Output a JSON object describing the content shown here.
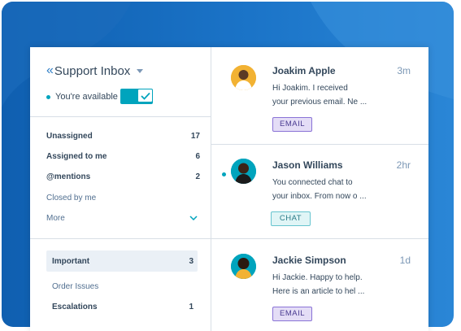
{
  "colors": {
    "accent": "#00a4bd",
    "text_dark": "#33475b",
    "text_muted": "#7c98b6",
    "background_blue": "#1b74c8",
    "email_tag": "#e4ddf6",
    "chat_tag": "#e0f5f6"
  },
  "sidebar": {
    "collapse_icon": "double-chevron-left-icon",
    "inbox_title": "Support Inbox",
    "availability_label": "You're available",
    "availability_on": true,
    "nav": [
      {
        "label": "Unassigned",
        "count": "17"
      },
      {
        "label": "Assigned to me",
        "count": "6"
      },
      {
        "label": "@mentions",
        "count": "2"
      },
      {
        "label": "Closed by me",
        "count": ""
      },
      {
        "label": "More",
        "count": ""
      }
    ],
    "views": [
      {
        "label": "Important",
        "count": "3",
        "selected": true
      },
      {
        "label": "Order Issues",
        "count": ""
      },
      {
        "label": "Escalations",
        "count": "1"
      }
    ]
  },
  "conversations": [
    {
      "name": "Joakim Apple",
      "time": "3m",
      "preview_line1": "Hi Joakim. I received",
      "preview_line2": "your previous email. Ne ...",
      "channel": "EMAIL",
      "unread": false
    },
    {
      "name": "Jason Williams",
      "time": "2hr",
      "preview_line1": "You connected chat to",
      "preview_line2": "your inbox. From now o ...",
      "channel": "CHAT",
      "unread": true
    },
    {
      "name": "Jackie Simpson",
      "time": "1d",
      "preview_line1": "Hi Jackie. Happy to help.",
      "preview_line2": "Here is an article to hel ...",
      "channel": "EMAIL",
      "unread": false
    }
  ]
}
